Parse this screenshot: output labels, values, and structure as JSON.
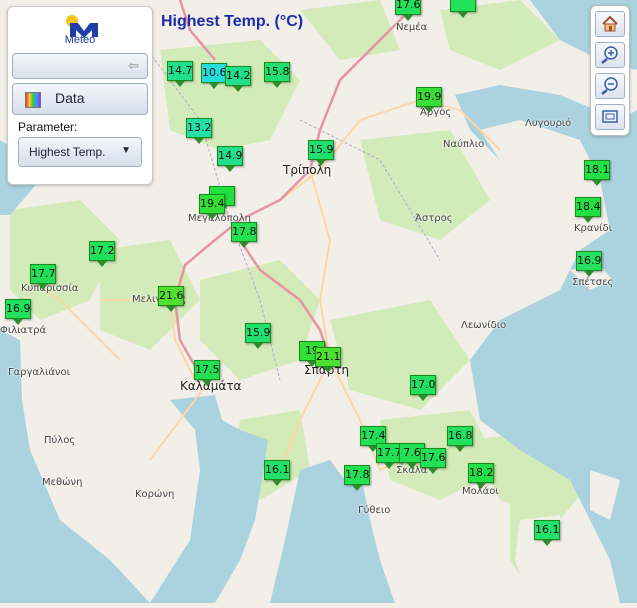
{
  "map_title": "Highest Temp. (°C)",
  "panel": {
    "logo_text": "Meteo",
    "data_button": "Data",
    "parameter_label": "Parameter:",
    "parameter_value": "Highest Temp."
  },
  "places": [
    {
      "name": "Νεμέα"
    },
    {
      "name": "Άργος"
    },
    {
      "name": "Λυγουριό"
    },
    {
      "name": "Ναύπλιο"
    },
    {
      "name": "Τρίπολη"
    },
    {
      "name": "Άστρος"
    },
    {
      "name": "Κρανίδι"
    },
    {
      "name": "Σπέτσες"
    },
    {
      "name": "Μεγαλόπολη"
    },
    {
      "name": "Κυπαρισσία"
    },
    {
      "name": "Φιλιατρά"
    },
    {
      "name": "Μελιγαλάς"
    },
    {
      "name": "Λεωνίδιο"
    },
    {
      "name": "Γαργαλιάνοι"
    },
    {
      "name": "Καλαμάτα"
    },
    {
      "name": "Σπάρτη"
    },
    {
      "name": "Πύλος"
    },
    {
      "name": "Μεθώνη"
    },
    {
      "name": "Κορώνη"
    },
    {
      "name": "Σκάλα"
    },
    {
      "name": "Μολάοι"
    },
    {
      "name": "Γύθειο"
    }
  ],
  "stations": [
    {
      "value": "17.6",
      "color": "#22e05a"
    },
    {
      "value": "",
      "color": "#22e05a"
    },
    {
      "value": "14.7",
      "color": "#22e08a"
    },
    {
      "value": "10.6",
      "color": "#22dede"
    },
    {
      "value": "14.2",
      "color": "#22e08a"
    },
    {
      "value": "15.8",
      "color": "#22e070"
    },
    {
      "value": "19.9",
      "color": "#36e034"
    },
    {
      "value": "13.2",
      "color": "#22e0a8"
    },
    {
      "value": "14.9",
      "color": "#22e08a"
    },
    {
      "value": "15.9",
      "color": "#22e070"
    },
    {
      "value": "18.1",
      "color": "#22e045"
    },
    {
      "value": "",
      "color": "#22e040"
    },
    {
      "value": "19.4",
      "color": "#30e034"
    },
    {
      "value": "18.4",
      "color": "#22e040"
    },
    {
      "value": "17.8",
      "color": "#22e050"
    },
    {
      "value": "17.2",
      "color": "#22e05a"
    },
    {
      "value": "16.9",
      "color": "#22e060"
    },
    {
      "value": "17.7",
      "color": "#22e055"
    },
    {
      "value": "21.6",
      "color": "#52e030"
    },
    {
      "value": "16.9",
      "color": "#22e060"
    },
    {
      "value": "15.9",
      "color": "#22e070"
    },
    {
      "value": "19",
      "color": "#30e034"
    },
    {
      "value": "21.1",
      "color": "#4ce030"
    },
    {
      "value": "17.5",
      "color": "#22e055"
    },
    {
      "value": "17.0",
      "color": "#22e060"
    },
    {
      "value": "17.4",
      "color": "#22e058"
    },
    {
      "value": "16.8",
      "color": "#22e062"
    },
    {
      "value": "17.7",
      "color": "#22e055"
    },
    {
      "value": "7.6",
      "color": "#22e055"
    },
    {
      "value": "17.6",
      "color": "#22e055"
    },
    {
      "value": "16.1",
      "color": "#22e068"
    },
    {
      "value": "17.8",
      "color": "#22e050"
    },
    {
      "value": "18.2",
      "color": "#22e048"
    },
    {
      "value": "16.1",
      "color": "#22e068"
    }
  ],
  "colors": {
    "title": "#1f2aa8",
    "sea": "#aad3df",
    "land": "#f2efe9",
    "forest": "#cdebb0",
    "motorway": "#e892a2"
  },
  "toolbar": [
    {
      "icon": "home-icon"
    },
    {
      "icon": "zoom-in-icon"
    },
    {
      "icon": "zoom-out-icon"
    },
    {
      "icon": "zoom-extent-icon"
    }
  ]
}
